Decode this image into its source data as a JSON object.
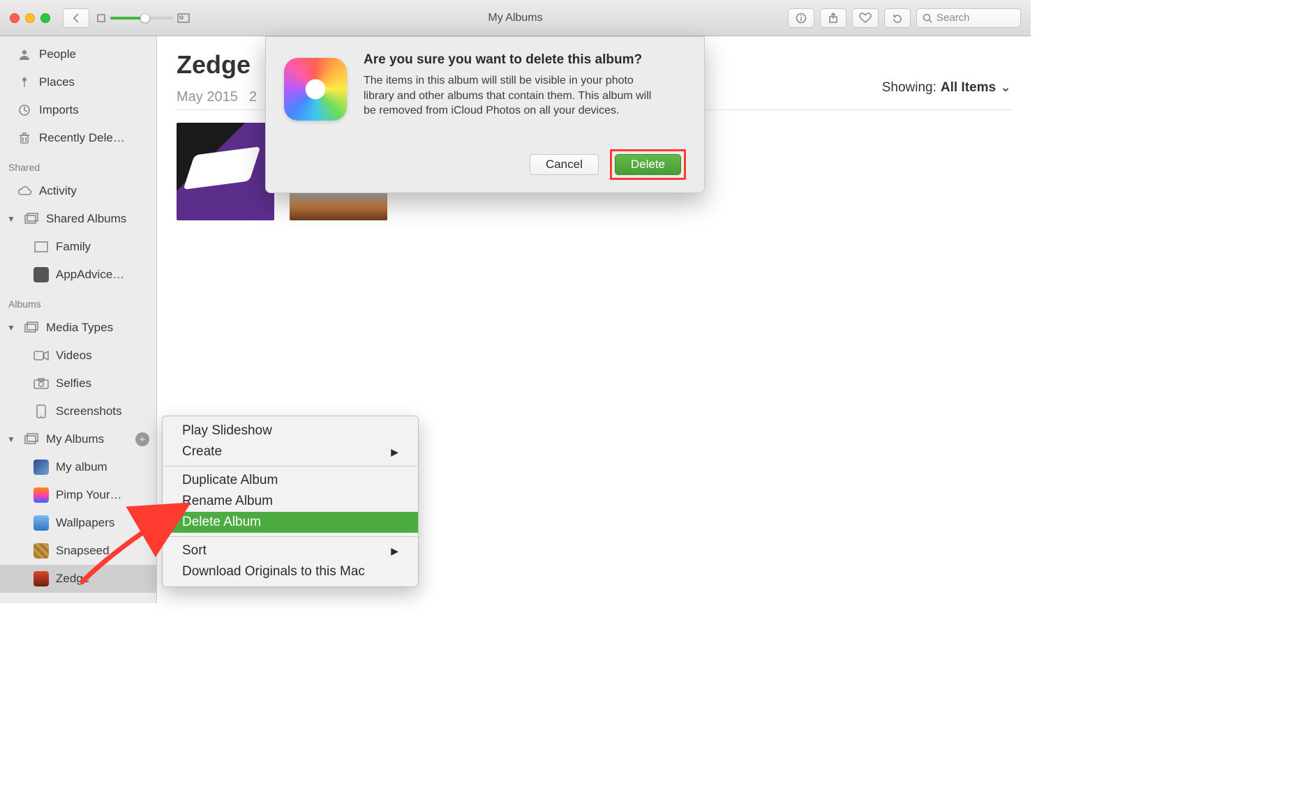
{
  "toolbar": {
    "title": "My Albums",
    "search_placeholder": "Search"
  },
  "sidebar": {
    "top": [
      {
        "label": "People"
      },
      {
        "label": "Places"
      },
      {
        "label": "Imports"
      },
      {
        "label": "Recently Dele…"
      }
    ],
    "shared_header": "Shared",
    "shared": [
      {
        "label": "Activity"
      },
      {
        "label": "Shared Albums",
        "expandable": true
      },
      {
        "label": "Family",
        "indent": true
      },
      {
        "label": "AppAdvice…",
        "indent": true
      }
    ],
    "albums_header": "Albums",
    "media_types_label": "Media Types",
    "media_types": [
      {
        "label": "Videos"
      },
      {
        "label": "Selfies"
      },
      {
        "label": "Screenshots"
      }
    ],
    "my_albums_label": "My Albums",
    "my_albums": [
      {
        "label": "My album"
      },
      {
        "label": "Pimp Your…"
      },
      {
        "label": "Wallpapers"
      },
      {
        "label": "Snapseed"
      },
      {
        "label": "Zedge",
        "selected": true
      }
    ]
  },
  "main": {
    "album_title": "Zedge",
    "album_month": "May 2015",
    "album_count": "2",
    "showing_label": "Showing:",
    "showing_value": "All Items"
  },
  "context_menu": {
    "items": [
      {
        "label": "Play Slideshow"
      },
      {
        "label": "Create",
        "submenu": true
      },
      {
        "sep": true
      },
      {
        "label": "Duplicate Album"
      },
      {
        "label": "Rename Album"
      },
      {
        "label": "Delete Album",
        "highlight": true
      },
      {
        "sep": true
      },
      {
        "label": "Sort",
        "submenu": true
      },
      {
        "label": "Download Originals to this Mac"
      }
    ]
  },
  "dialog": {
    "title": "Are you sure you want to delete this album?",
    "body": "The items in this album will still be visible in your photo library and other albums that contain them. This album will be removed from iCloud Photos on all your devices.",
    "cancel": "Cancel",
    "delete": "Delete"
  }
}
